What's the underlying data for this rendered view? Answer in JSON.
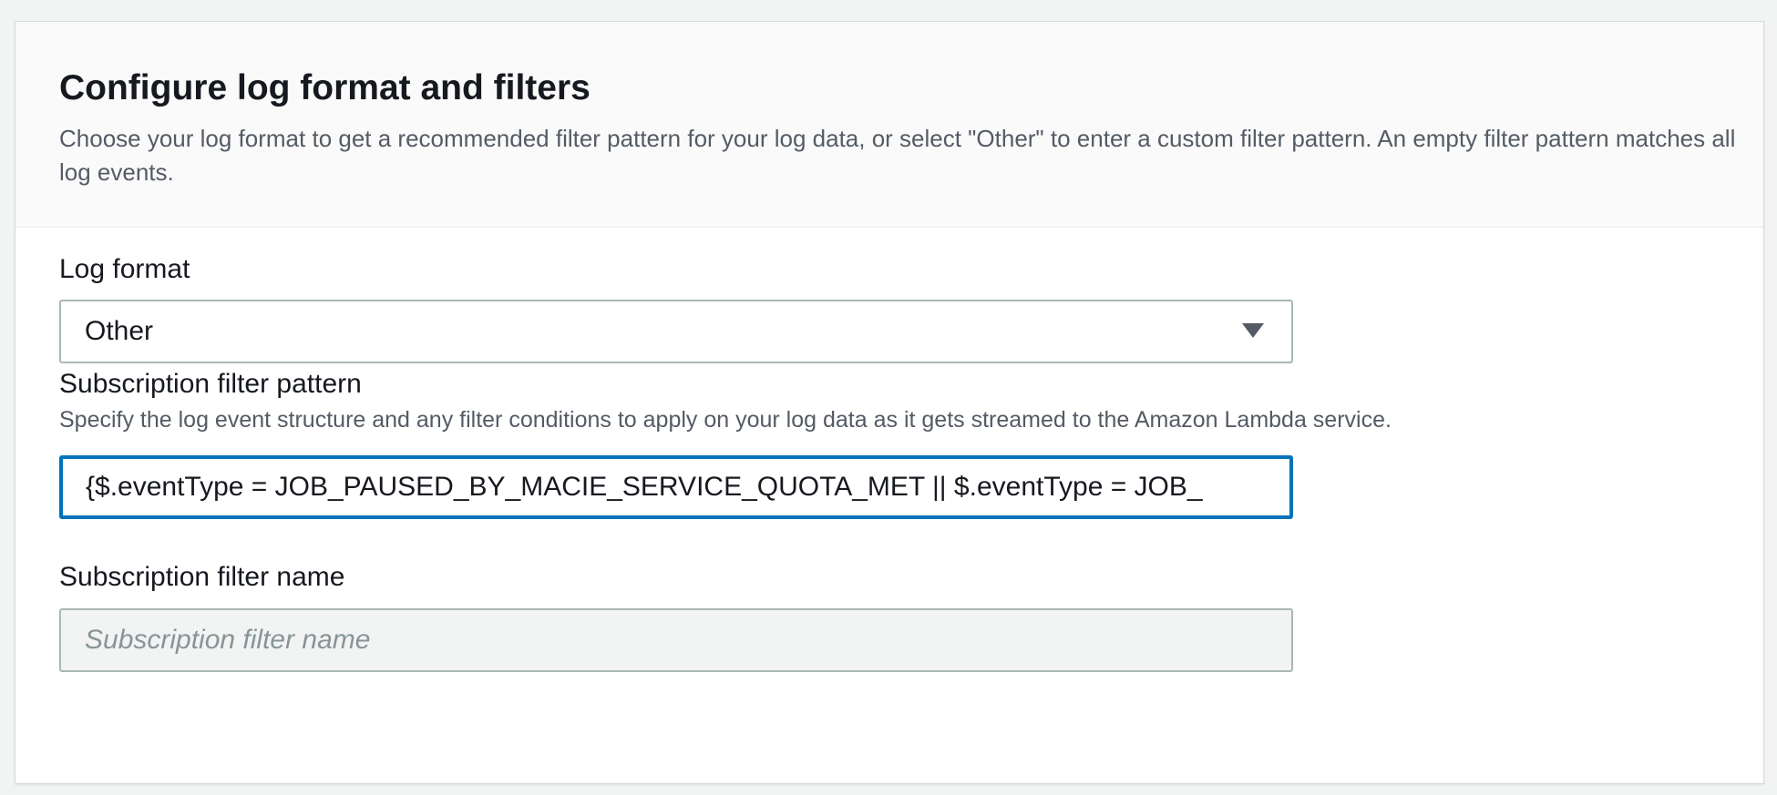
{
  "section": {
    "title": "Configure log format and filters",
    "description": "Choose your log format to get a recommended filter pattern for your log data, or select \"Other\" to enter a custom filter pattern. An empty filter pattern matches all log events."
  },
  "log_format": {
    "label": "Log format",
    "selected": "Other"
  },
  "filter_pattern": {
    "label": "Subscription filter pattern",
    "description": "Specify the log event structure and any filter conditions to apply on your log data as it gets streamed to the Amazon Lambda service.",
    "value": "{$.eventType = JOB_PAUSED_BY_MACIE_SERVICE_QUOTA_MET || $.eventType = JOB_"
  },
  "filter_name": {
    "label": "Subscription filter name",
    "placeholder": "Subscription filter name",
    "value": ""
  },
  "colors": {
    "focus_border": "#0073bb",
    "input_border": "#aab7b8",
    "placeholder": "#879596"
  },
  "icons": {
    "select_caret": "caret-down-icon"
  }
}
